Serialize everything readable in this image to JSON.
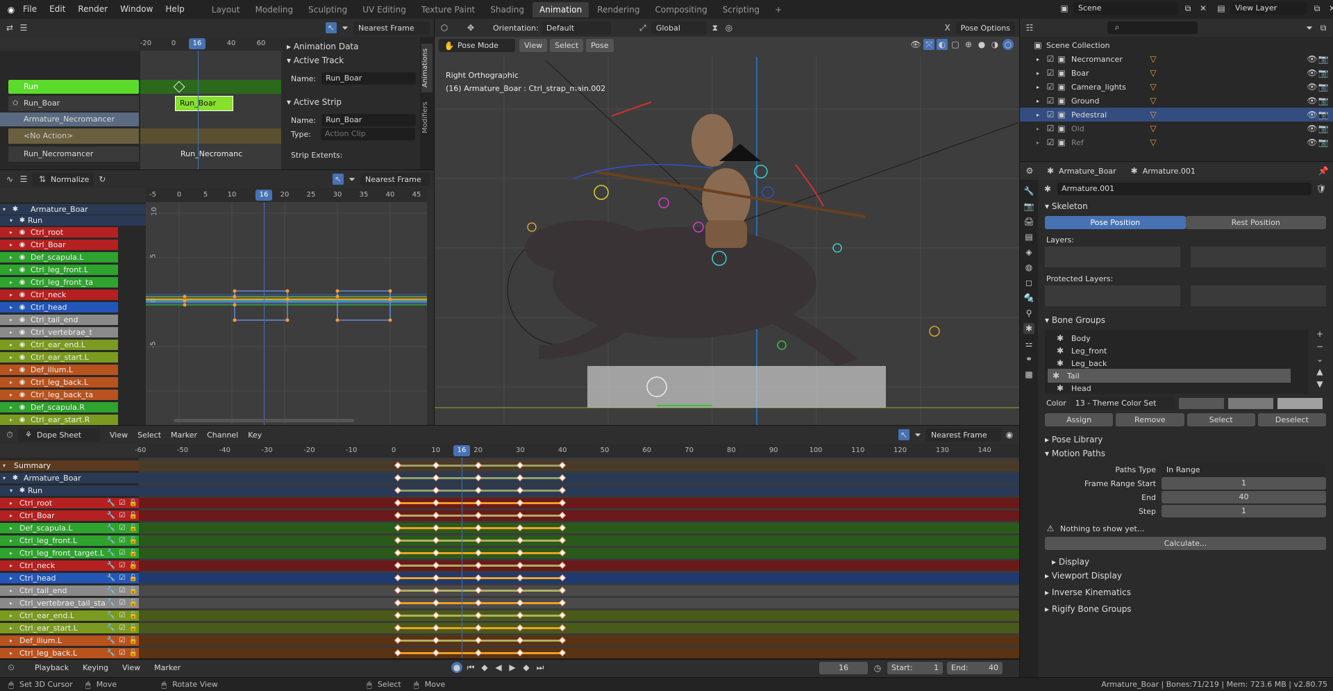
{
  "menu": [
    "File",
    "Edit",
    "Render",
    "Window",
    "Help"
  ],
  "workspaces": [
    "Layout",
    "Modeling",
    "Sculpting",
    "UV Editing",
    "Texture Paint",
    "Shading",
    "Animation",
    "Rendering",
    "Compositing",
    "Scripting",
    "+"
  ],
  "active_workspace": "Animation",
  "topright": {
    "scene": "Scene",
    "view_layer": "View Layer"
  },
  "nla": {
    "snap": "Nearest Frame",
    "ruler": [
      "-20",
      "0",
      "16",
      "40",
      "60"
    ],
    "current_frame": "16",
    "tracks": [
      {
        "label": "Run",
        "color": "#5bdc2a"
      },
      {
        "label": "Run_Boar",
        "color": "#3a3a3a"
      },
      {
        "label": "Armature_Necromancer",
        "color": "#5a6a80"
      },
      {
        "label": "<No Action>",
        "color": "#6a6040"
      },
      {
        "label": "Run_Necromancer",
        "color": "#3a3a3a"
      }
    ],
    "strips": [
      "Run_Boar",
      "Run_Necromanc"
    ],
    "side_tabs": [
      "Animations",
      "Modifiers"
    ],
    "sidebar": {
      "animation_data": "Animation Data",
      "active_track": "Active Track",
      "track_name_label": "Name:",
      "track_name": "Run_Boar",
      "active_strip": "Active Strip",
      "strip_name_label": "Name:",
      "strip_name": "Run_Boar",
      "type_label": "Type:",
      "type": "Action Clip",
      "strip_extents": "Strip Extents:"
    }
  },
  "graph": {
    "normalize": "Normalize",
    "snap": "Nearest Frame",
    "ruler": [
      "-5",
      "0",
      "5",
      "10",
      "16",
      "20",
      "25",
      "30",
      "35",
      "40",
      "45"
    ],
    "current_frame": "16",
    "yticks": [
      "10",
      "5",
      "0",
      "-5"
    ],
    "armature": "Armature_Boar",
    "action": "Run",
    "channels": [
      {
        "name": "Ctrl_root",
        "color": "#b52020"
      },
      {
        "name": "Ctrl_Boar",
        "color": "#b52020"
      },
      {
        "name": "Def_scapula.L",
        "color": "#2ea32e"
      },
      {
        "name": "Ctrl_leg_front.L",
        "color": "#2ea32e"
      },
      {
        "name": "Ctrl_leg_front_ta",
        "color": "#2ea32e"
      },
      {
        "name": "Ctrl_neck",
        "color": "#b52020"
      },
      {
        "name": "Ctrl_head",
        "color": "#2456b8"
      },
      {
        "name": "Ctrl_tail_end",
        "color": "#8a8a8a"
      },
      {
        "name": "Ctrl_vertebrae_t",
        "color": "#8a8a8a"
      },
      {
        "name": "Ctrl_ear_end.L",
        "color": "#7a9a20"
      },
      {
        "name": "Ctrl_ear_start.L",
        "color": "#7a9a20"
      },
      {
        "name": "Def_ilium.L",
        "color": "#b8531e"
      },
      {
        "name": "Ctrl_leg_back.L",
        "color": "#b8531e"
      },
      {
        "name": "Ctrl_leg_back_ta",
        "color": "#b8531e"
      },
      {
        "name": "Def_scapula.R",
        "color": "#2ea32e"
      },
      {
        "name": "Ctrl_ear_start.R",
        "color": "#7a9a20"
      }
    ]
  },
  "viewport": {
    "mode": "Pose Mode",
    "orientation_label": "Orientation:",
    "orientation": "Default",
    "transform": "Global",
    "menus": [
      "View",
      "Select",
      "Pose"
    ],
    "pose_options": "Pose Options",
    "overlay_title": "Right Orthographic",
    "overlay_sub": "(16) Armature_Boar : Ctrl_strap_main.002"
  },
  "dopesheet": {
    "mode": "Dope Sheet",
    "menus": [
      "View",
      "Select",
      "Marker",
      "Channel",
      "Key"
    ],
    "snap": "Nearest Frame",
    "ruler": [
      "-60",
      "-50",
      "-40",
      "-30",
      "-20",
      "-10",
      "0",
      "10",
      "16",
      "20",
      "30",
      "40",
      "50",
      "60",
      "70",
      "80",
      "90",
      "100",
      "110",
      "120",
      "130",
      "140"
    ],
    "current_frame": "16",
    "summary": "Summary",
    "armature": "Armature_Boar",
    "action": "Run",
    "channels": [
      {
        "name": "Ctrl_root",
        "color": "#b52020",
        "row": "#6a1a1a"
      },
      {
        "name": "Ctrl_Boar",
        "color": "#b52020",
        "row": "#6a1a1a"
      },
      {
        "name": "Def_scapula.L",
        "color": "#2ea32e",
        "row": "#2a5a1a"
      },
      {
        "name": "Ctrl_leg_front.L",
        "color": "#2ea32e",
        "row": "#2a5a1a"
      },
      {
        "name": "Ctrl_leg_front_target.L",
        "color": "#2ea32e",
        "row": "#2a5a1a"
      },
      {
        "name": "Ctrl_neck",
        "color": "#b52020",
        "row": "#6a1a1a"
      },
      {
        "name": "Ctrl_head",
        "color": "#2456b8",
        "row": "#1e3a70"
      },
      {
        "name": "Ctrl_tail_end",
        "color": "#8a8a8a",
        "row": "#4a4a4a"
      },
      {
        "name": "Ctrl_vertebrae_tail_sta",
        "color": "#8a8a8a",
        "row": "#4a4a4a"
      },
      {
        "name": "Ctrl_ear_end.L",
        "color": "#7a9a20",
        "row": "#4a5a1a"
      },
      {
        "name": "Ctrl_ear_start.L",
        "color": "#7a9a20",
        "row": "#4a5a1a"
      },
      {
        "name": "Def_ilium.L",
        "color": "#b8531e",
        "row": "#5a3214"
      },
      {
        "name": "Ctrl_leg_back.L",
        "color": "#b8531e",
        "row": "#5a3214"
      }
    ]
  },
  "timeline": {
    "menus": [
      "Playback",
      "Keying",
      "View",
      "Marker"
    ],
    "frame": "16",
    "start_label": "Start:",
    "start": "1",
    "end_label": "End:",
    "end": "40"
  },
  "outliner": {
    "scene_collection": "Scene Collection",
    "items": [
      "Necromancer",
      "Boar",
      "Camera_lights",
      "Ground",
      "Pedestral",
      "Old",
      "Ref"
    ]
  },
  "properties": {
    "object": "Armature_Boar",
    "data": "Armature.001",
    "data_name": "Armature.001",
    "skeleton": "Skeleton",
    "pose_position": "Pose Position",
    "rest_position": "Rest Position",
    "layers": "Layers:",
    "protected_layers": "Protected Layers:",
    "bone_groups": "Bone Groups",
    "groups": [
      "Body",
      "Leg_front",
      "Leg_back",
      "Tail",
      "Head"
    ],
    "active_group": "Tail",
    "color_label": "Color",
    "color_set": "13 - Theme Color Set",
    "assign": "Assign",
    "remove": "Remove",
    "select": "Select",
    "deselect": "Deselect",
    "pose_library": "Pose Library",
    "motion_paths": "Motion Paths",
    "paths_type_label": "Paths Type",
    "paths_type": "In Range",
    "frame_range_start_label": "Frame Range Start",
    "frame_range_start": "1",
    "end_label": "End",
    "end": "40",
    "step_label": "Step",
    "step": "1",
    "nothing": "Nothing to show yet...",
    "calculate": "Calculate...",
    "display": "Display",
    "viewport_display": "Viewport Display",
    "inverse_kinematics": "Inverse Kinematics",
    "rigify": "Rigify Bone Groups"
  },
  "status": {
    "left": [
      "Set 3D Cursor",
      "Move",
      "Rotate View",
      "Select",
      "Move"
    ],
    "right": "Armature_Boar | Bones:71/219 | Mem: 723.6 MB | v2.80.75"
  }
}
